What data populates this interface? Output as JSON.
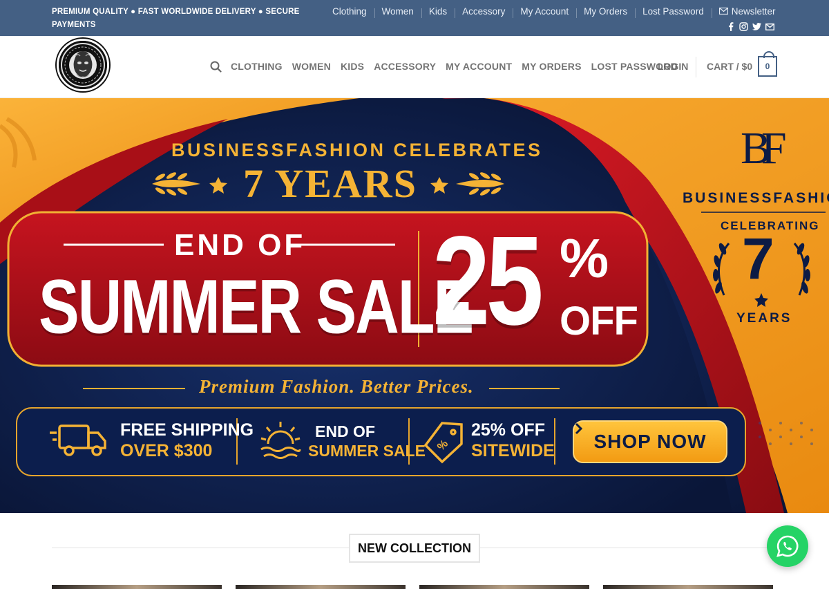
{
  "topbar": {
    "promo": "PREMIUM QUALITY ● FAST WORLDWIDE DELIVERY ● SECURE PAYMENTS",
    "links": [
      "Clothing",
      "Women",
      "Kids",
      "Accessory",
      "My Account",
      "My Orders",
      "Lost Password"
    ],
    "newsletter": "Newsletter",
    "social_icons": [
      "facebook-icon",
      "instagram-icon",
      "twitter-icon",
      "email-icon"
    ]
  },
  "header": {
    "nav": [
      "CLOTHING",
      "WOMEN",
      "KIDS",
      "ACCESSORY",
      "MY ACCOUNT",
      "MY ORDERS",
      "LOST PASSWORD"
    ],
    "login": "LOGIN",
    "cart_label": "CART / $0",
    "cart_count": "0"
  },
  "banner": {
    "brand_line": "BUSINESSFASHION CELEBRATES",
    "years": "7 YEARS",
    "end_of": "END OF",
    "summer_sale": "SUMMER SALE",
    "discount": "25",
    "percent": "%",
    "off": "OFF",
    "tagline": "Premium Fashion. Better Prices.",
    "features": [
      {
        "line1": "FREE SHIPPING",
        "line2": "OVER $300",
        "icon": "truck-icon"
      },
      {
        "line1": "END OF",
        "line2": "SUMMER SALE",
        "icon": "sunset-icon"
      },
      {
        "line1": "25% OFF",
        "line2": "SITEWIDE",
        "icon": "price-tag-icon"
      }
    ],
    "cta": "SHOP NOW",
    "side_monogram": "BF",
    "side_brand": "BUSINESSFASHIO",
    "side_celebrating": "CELEBRATING",
    "side_number": "7",
    "side_years": "YEARS"
  },
  "section": {
    "title": "NEW COLLECTION"
  },
  "colors": {
    "topbar": "#446084",
    "banner_navy": "#0c1b45",
    "banner_red": "#b5121b",
    "banner_gold": "#f5a623",
    "whatsapp": "#25d366"
  }
}
